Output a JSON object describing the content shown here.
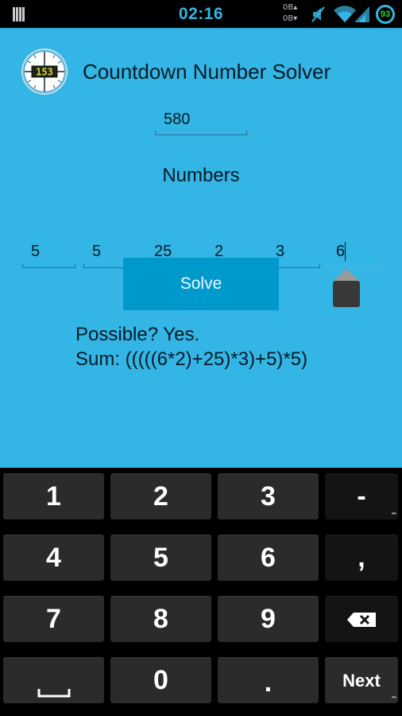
{
  "status_bar": {
    "time": "02:16",
    "data_up": "0B▴",
    "data_down": "0B▾",
    "battery": "93",
    "icons": [
      "notification-bars-icon",
      "mute-icon",
      "wifi-icon",
      "signal-icon",
      "battery-icon"
    ]
  },
  "app": {
    "title": "Countdown Number Solver",
    "icon": "stopwatch-153-icon",
    "target_value": "580",
    "numbers_label": "Numbers",
    "numbers": [
      "5",
      "5",
      "25",
      "2",
      "3",
      "6"
    ],
    "solve_label": "Solve",
    "result_possible": "Possible? Yes.",
    "result_sum": "Sum: (((((6*2)+25)*3)+5)*5)",
    "colors": {
      "background": "#33b5e5",
      "button": "#0099cc"
    }
  },
  "keyboard": {
    "rows": [
      [
        "1",
        "2",
        "3",
        "-"
      ],
      [
        "4",
        "5",
        "6",
        ","
      ],
      [
        "7",
        "8",
        "9",
        "⌫"
      ],
      [
        "␣",
        "0",
        ".",
        "Next"
      ]
    ],
    "dash_label": "-",
    "comma_label": ",",
    "next_label": "Next",
    "more_dots": "•••"
  }
}
